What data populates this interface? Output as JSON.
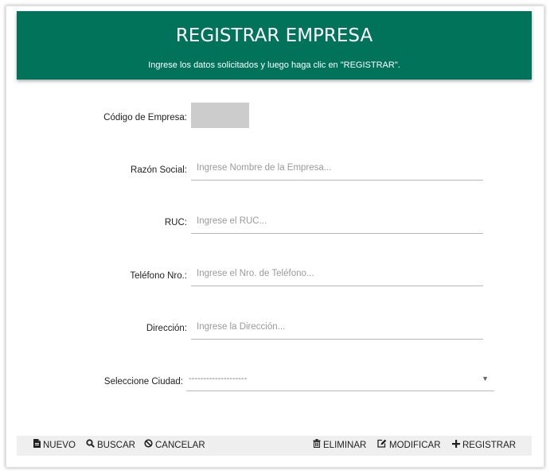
{
  "header": {
    "title": "REGISTRAR EMPRESA",
    "subtitle": "Ingrese los datos solicitados y luego haga clic en \"REGISTRAR\"."
  },
  "form": {
    "codigo_label": "Código de Empresa:",
    "codigo_value": "",
    "razon_label": "Razón Social:",
    "razon_placeholder": "Ingrese Nombre de la Empresa...",
    "ruc_label": "RUC:",
    "ruc_placeholder": "Ingrese el RUC...",
    "telefono_label": "Teléfono Nro.:",
    "telefono_placeholder": "Ingrese el Nro. de Teléfono...",
    "direccion_label": "Dirección:",
    "direccion_placeholder": "Ingrese la Dirección...",
    "ciudad_label": "Seleccione Ciudad:",
    "ciudad_selected": "--------------------"
  },
  "footer": {
    "nuevo": "NUEVO",
    "buscar": "BUSCAR",
    "cancelar": "CANCELAR",
    "eliminar": "ELIMINAR",
    "modificar": "MODIFICAR",
    "registrar": "REGISTRAR"
  },
  "icons": {
    "nuevo": "file-icon",
    "buscar": "search-icon",
    "cancelar": "ban-icon",
    "eliminar": "trash-icon",
    "modificar": "edit-icon",
    "registrar": "plus-icon"
  },
  "colors": {
    "header_bg": "#00735a",
    "header_text": "#ffffff",
    "footer_bg": "#efefef",
    "code_box": "#cccccc"
  }
}
